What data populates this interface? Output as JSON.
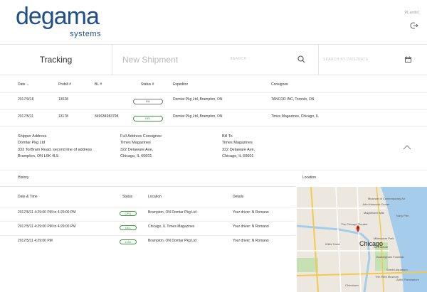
{
  "header": {
    "logo_word": "degama",
    "logo_sub": "systems",
    "user": "PL andol"
  },
  "tabs": {
    "tracking": "Tracking",
    "new_shipment": "New Shipment",
    "search_placeholder": "SEARCH",
    "date_placeholder": "SEARCH BY DATE/DATE"
  },
  "table": {
    "headers": {
      "date": "Date ⌄",
      "probill": "Probill #",
      "bl": "BL #",
      "status": "Status #",
      "expeditor": "Expeditor",
      "consignee": "Consignee"
    },
    "rows": [
      {
        "date": "2017/9/18",
        "probill": "13028",
        "bl": "",
        "status": "INL",
        "expeditor": "Domtar Pkg Ltd, Brampton, ON",
        "consignee": "TANCOR INC, Toronto, ON"
      },
      {
        "date": "2017/5/11",
        "probill": "13178",
        "bl": "349634983798",
        "status": "DEL",
        "expeditor": "Domtar Pkg Ltd, Brampton, ON",
        "consignee": "Times Magazines, Chicago, IL"
      }
    ]
  },
  "detail": {
    "shipper_title": "Shipper Address",
    "shipper_lines": [
      "Domtar Pkg Ltd",
      "333 TorBram Road, second line of address",
      "Brampton, ON L6K 4L5"
    ],
    "consignee_title": "Full Address Consignee",
    "consignee_lines": [
      "Times Magazines",
      "322 Delaware Ave,",
      "Chicago, IL 60601"
    ],
    "bill_title": "Bill To",
    "bill_lines": [
      "Times Magazines",
      "322 Delaware Ave,",
      "Chicago, IL 60601"
    ]
  },
  "history": {
    "title": "History",
    "location_title": "Location",
    "headers": {
      "datetime": "Date & Time",
      "status": "Status",
      "location": "Location",
      "details": "Details"
    },
    "rows": [
      {
        "datetime": "2017/5/11 4:29:00 PM to 4:29:00 PM",
        "status": "OPU",
        "location": "Brampton, ON Domtar Pkg Ltd",
        "details": "Your driver: N Romano"
      },
      {
        "datetime": "2017/5/11 4:29:00 PM to 4:29:00 PM",
        "status": "DEL",
        "location": "Chicago, IL Times Magazines",
        "details": "Your driver: N Romano"
      },
      {
        "datetime": "2017/5/11 4:29:00 PM",
        "status": "LOD",
        "location": "Brampton, ON Domtar Pkg Ltd",
        "details": "Your driver: N Romano"
      }
    ]
  },
  "map": {
    "city": "Chicago",
    "labels": [
      "Museum of Contemporary Art",
      "Navy Pier",
      "John Hancock Center",
      "Magnificent Mile",
      "The Chicago Theatre",
      "Millennium Park",
      "Buckingham Fountain",
      "Willis Tower",
      "Art Institute",
      "Shedd Aquarium",
      "The Field Museum",
      "Chinatown",
      "Adler Planetarium"
    ],
    "colors": {
      "water": "#a5cdeb",
      "land": "#ece8df",
      "park": "#c6e2b4",
      "road": "#f4c84e",
      "marker": "#d93025"
    }
  }
}
